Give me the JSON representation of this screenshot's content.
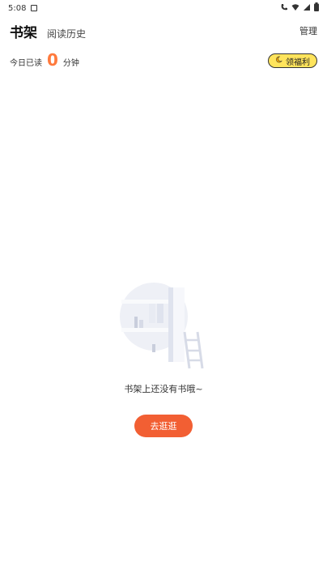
{
  "status_bar": {
    "time": "5:08"
  },
  "tabs": {
    "active": "书架",
    "other": "阅读历史"
  },
  "header": {
    "manage_label": "管理"
  },
  "today": {
    "label": "今日已读",
    "value": "0",
    "unit": "分钟"
  },
  "reward_button": {
    "label": "领福利",
    "bg": "#ffe45c"
  },
  "empty_state": {
    "message": "书架上还没有书哦~",
    "button_label": "去逛逛"
  },
  "colors": {
    "accent": "#f25f33",
    "highlight": "#ff7a3d"
  }
}
